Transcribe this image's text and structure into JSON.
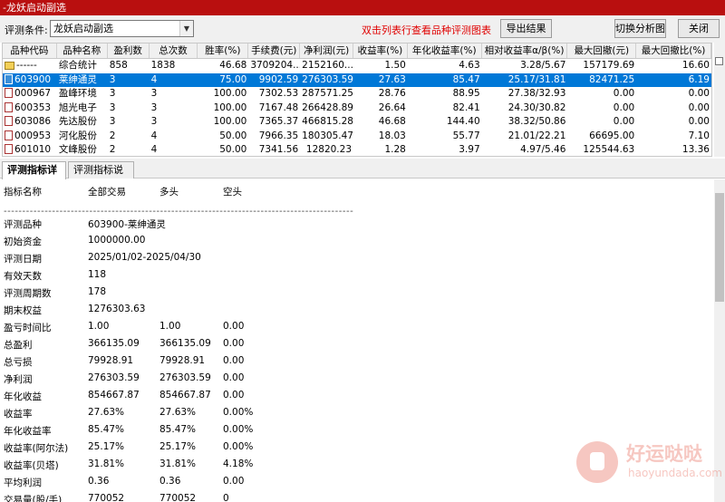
{
  "window": {
    "title": "-龙妖启动副选"
  },
  "toolbar": {
    "condition_label": "评测条件:",
    "condition_value": "龙妖启动副选",
    "hint": "双击列表行查看品种评测图表",
    "export_label": "导出结果",
    "switch_label": "切换分析图",
    "close_label": "关闭"
  },
  "table": {
    "headers": [
      "品种代码",
      "品种名称",
      "盈利数",
      "总次数",
      "胜率(%)",
      "手续费(元)",
      "净利润(元)",
      "收益率(%)",
      "年化收益率(%)",
      "相对收益率α/β(%)",
      "最大回撤(元)",
      "最大回撤比(%)"
    ],
    "rows": [
      [
        "------",
        "综合统计",
        "858",
        "1838",
        "46.68",
        "3709204...",
        "2152160...",
        "1.50",
        "4.63",
        "3.28/5.67",
        "157179.69",
        "16.60"
      ],
      [
        "603900",
        "莱绅通灵",
        "3",
        "4",
        "75.00",
        "9902.59",
        "276303.59",
        "27.63",
        "85.47",
        "25.17/31.81",
        "82471.25",
        "6.19"
      ],
      [
        "000967",
        "盈峰环境",
        "3",
        "3",
        "100.00",
        "7302.53",
        "287571.25",
        "28.76",
        "88.95",
        "27.38/32.93",
        "0.00",
        "0.00"
      ],
      [
        "600353",
        "旭光电子",
        "3",
        "3",
        "100.00",
        "7167.48",
        "266428.89",
        "26.64",
        "82.41",
        "24.30/30.82",
        "0.00",
        "0.00"
      ],
      [
        "603086",
        "先达股份",
        "3",
        "3",
        "100.00",
        "7365.37",
        "466815.28",
        "46.68",
        "144.40",
        "38.32/50.86",
        "0.00",
        "0.00"
      ],
      [
        "000953",
        "河化股份",
        "2",
        "4",
        "50.00",
        "7966.35",
        "180305.47",
        "18.03",
        "55.77",
        "21.01/22.21",
        "66695.00",
        "7.10"
      ],
      [
        "601010",
        "文峰股份",
        "2",
        "4",
        "50.00",
        "7341.56",
        "12820.23",
        "1.28",
        "3.97",
        "4.97/5.46",
        "125544.63",
        "13.36"
      ]
    ]
  },
  "tabs": [
    "评测指标详情",
    "评测指标说明"
  ],
  "detail": {
    "header": {
      "c0": "指标名称",
      "c1": "全部交易",
      "c2": "多头",
      "c3": "空头"
    },
    "separator": "----------------------------------------------------------------------------------------------",
    "lines": [
      {
        "c0": "评测品种",
        "c1": "603900-莱绅通灵"
      },
      {
        "c0": "初始资金",
        "c1": "1000000.00"
      },
      {
        "c0": "评测日期",
        "c1": "2025/01/02-2025/04/30"
      },
      {
        "c0": "有效天数",
        "c1": "118"
      },
      {
        "c0": "评测周期数",
        "c1": "178"
      },
      {
        "c0": "期末权益",
        "c1": "1276303.63"
      },
      {
        "c0": "盈亏时间比",
        "c1": "1.00",
        "c2": "1.00",
        "c3": "0.00"
      },
      {
        "c0": "总盈利",
        "c1": "366135.09",
        "c2": "366135.09",
        "c3": "0.00"
      },
      {
        "c0": "总亏损",
        "c1": "79928.91",
        "c2": "79928.91",
        "c3": "0.00"
      },
      {
        "c0": "净利润",
        "c1": "276303.59",
        "c2": "276303.59",
        "c3": "0.00"
      },
      {
        "c0": "年化收益",
        "c1": "854667.87",
        "c2": "854667.87",
        "c3": "0.00"
      },
      {
        "c0": "收益率",
        "c1": "27.63%",
        "c2": "27.63%",
        "c3": "0.00%"
      },
      {
        "c0": "年化收益率",
        "c1": "85.47%",
        "c2": "85.47%",
        "c3": "0.00%"
      },
      {
        "c0": "收益率(阿尔法)",
        "c1": "25.17%",
        "c2": "25.17%",
        "c3": "0.00%"
      },
      {
        "c0": "收益率(贝塔)",
        "c1": "31.81%",
        "c2": "31.81%",
        "c3": "4.18%"
      },
      {
        "c0": "平均利润",
        "c1": "0.36",
        "c2": "0.36",
        "c3": "0.00"
      },
      {
        "c0": "交易量(股/手)",
        "c1": "770052",
        "c2": "770052",
        "c3": "0"
      }
    ]
  },
  "watermark": {
    "title": "好运哒哒",
    "url": "haoyundada.com"
  }
}
